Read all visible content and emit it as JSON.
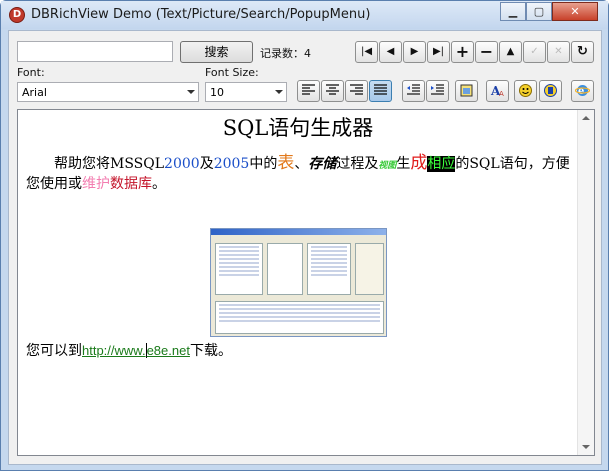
{
  "window": {
    "title": "DBRichView Demo (Text/Picture/Search/PopupMenu)",
    "app_icon_letter": "D",
    "buttons": [
      "minimize-icon",
      "maximize-icon",
      "close-icon"
    ]
  },
  "toolbar": {
    "search_input_value": "",
    "search_button": "搜索",
    "record_count_label": "记录数：",
    "record_count": "4",
    "nav_buttons": [
      "first-record-icon",
      "prior-record-icon",
      "next-record-icon",
      "last-record-icon",
      "insert-icon",
      "delete-icon",
      "edit-icon",
      "post-icon",
      "cancel-icon",
      "refresh-icon"
    ]
  },
  "format": {
    "font_label": "Font:",
    "font_value": "Arial",
    "size_label": "Font Size:",
    "size_value": "10",
    "align_buttons": [
      "align-left-icon",
      "align-center-icon",
      "align-right-icon",
      "align-justify-icon"
    ],
    "indent_buttons": [
      "outdent-icon",
      "indent-icon"
    ],
    "misc_buttons": [
      "insert-picture-icon",
      "font-style-icon",
      "insert-smiley-icon",
      "insert-object-icon",
      "insert-hyperlink-icon"
    ],
    "pressed": "align-justify-icon"
  },
  "document": {
    "title": "SQL语句生成器",
    "p1_a": "帮助您将",
    "p1_b": "MSSQL",
    "p1_c": "2000",
    "p1_d": "及",
    "p1_e": "2005",
    "p1_f": "中的",
    "p1_g": "表",
    "p1_h": "、",
    "p1_i": "存储",
    "p1_j": "过程及",
    "p1_k": "视图",
    "p1_l": "生",
    "p1_m": "成",
    "p1_n": "相应",
    "p1_o": "的SQL语句，方便您使用或",
    "p1_p": "维护",
    "p1_q": "数据库",
    "p1_r": "。",
    "line2_prefix": "您可以到",
    "link_a": "http://www.",
    "link_b": "e8e.net",
    "line2_suffix": "下载。"
  },
  "colors": {
    "blue": "#1b4fc9",
    "orange": "#e2791b",
    "green": "#36c936",
    "red": "#e01b1b",
    "pink": "#f37db0",
    "crimson": "#c4152b",
    "link": "#1a7a1a"
  }
}
